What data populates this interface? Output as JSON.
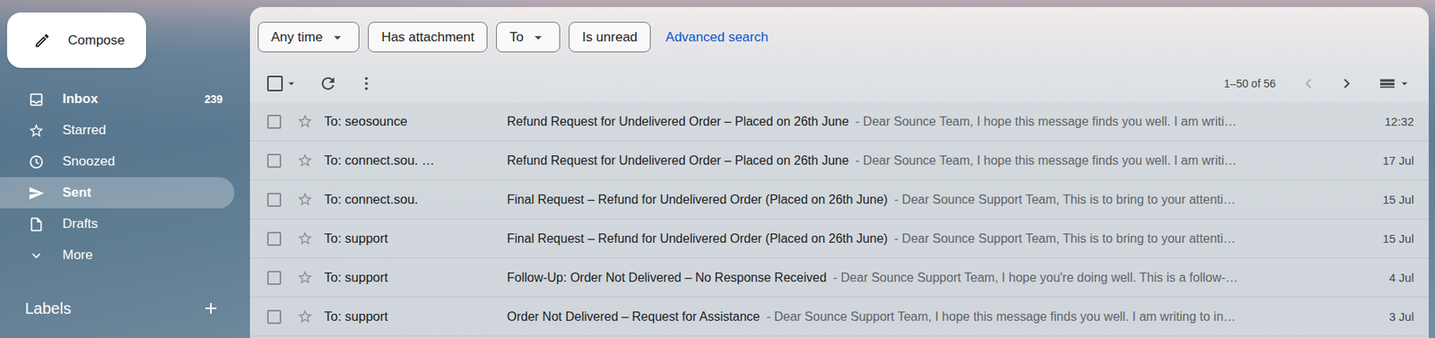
{
  "compose": {
    "label": "Compose"
  },
  "sidebar": {
    "items": [
      {
        "label": "Inbox",
        "count": "239",
        "unread": true,
        "selected": false
      },
      {
        "label": "Starred",
        "count": "",
        "unread": false,
        "selected": false
      },
      {
        "label": "Snoozed",
        "count": "",
        "unread": false,
        "selected": false
      },
      {
        "label": "Sent",
        "count": "",
        "unread": false,
        "selected": true
      },
      {
        "label": "Drafts",
        "count": "",
        "unread": false,
        "selected": false
      },
      {
        "label": "More",
        "count": "",
        "unread": false,
        "selected": false
      }
    ],
    "labels_title": "Labels"
  },
  "filters": [
    {
      "label": "Any time",
      "dropdown": true
    },
    {
      "label": "Has attachment",
      "dropdown": false
    },
    {
      "label": "To",
      "dropdown": true
    },
    {
      "label": "Is unread",
      "dropdown": false
    }
  ],
  "advanced_search": "Advanced search",
  "pagination": {
    "range": "1–50 of 56",
    "prev_disabled": true,
    "next_disabled": false
  },
  "rows": [
    {
      "recipient": "To: seosounce",
      "subject": "Refund Request for Undelivered Order – Placed on 26th June",
      "snippet": "- Dear Sounce Team, I hope this message finds you well. I am writi…",
      "date": "12:32",
      "unread": false,
      "starred": false,
      "checked": false
    },
    {
      "recipient": "To: connect.sou. …",
      "subject": "Refund Request for Undelivered Order – Placed on 26th June",
      "snippet": "- Dear Sounce Team, I hope this message finds you well. I am writi…",
      "date": "17 Jul",
      "unread": false,
      "starred": false,
      "checked": false
    },
    {
      "recipient": "To: connect.sou.",
      "subject": "Final Request – Refund for Undelivered Order (Placed on 26th June)",
      "snippet": "- Dear Sounce Support Team, This is to bring to your attenti…",
      "date": "15 Jul",
      "unread": false,
      "starred": false,
      "checked": false
    },
    {
      "recipient": "To: support",
      "subject": "Final Request – Refund for Undelivered Order (Placed on 26th June)",
      "snippet": "- Dear Sounce Support Team, This is to bring to your attenti…",
      "date": "15 Jul",
      "unread": false,
      "starred": false,
      "checked": false
    },
    {
      "recipient": "To: support",
      "subject": "Follow-Up: Order Not Delivered – No Response Received",
      "snippet": "- Dear Sounce Support Team, I hope you're doing well. This is a follow-…",
      "date": "4 Jul",
      "unread": false,
      "starred": false,
      "checked": false
    },
    {
      "recipient": "To: support",
      "subject": "Order Not Delivered – Request for Assistance",
      "snippet": "- Dear Sounce Support Team, I hope this message finds you well. I am writing to in…",
      "date": "3 Jul",
      "unread": false,
      "starred": false,
      "checked": false
    }
  ]
}
